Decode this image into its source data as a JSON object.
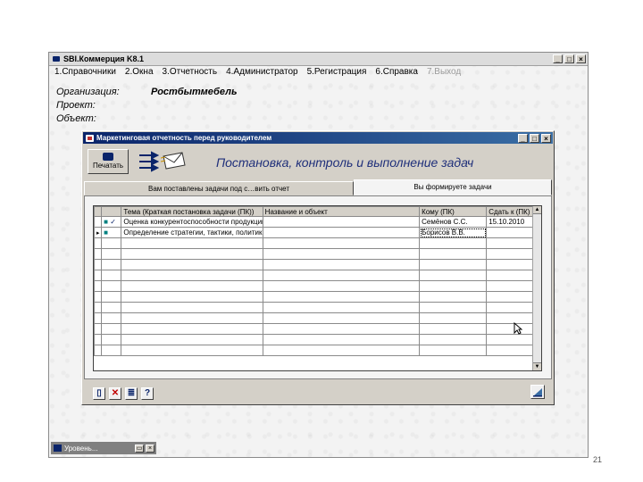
{
  "window": {
    "title": "SBI.Коммерция K8.1",
    "btn_minimize": "_",
    "btn_maximize": "□",
    "btn_close": "×"
  },
  "menu": [
    "1.Справочники",
    "2.Окна",
    "3.Отчетность",
    "4.Администратор",
    "5.Регистрация",
    "6.Справка",
    "7.Выход"
  ],
  "info": {
    "org_label": "Организация:",
    "org_value": "Ростбытмебель",
    "project_label": "Проект:",
    "object_label": "Объект:"
  },
  "dialog": {
    "title": "Маркетинговая отчетность перед руководителем",
    "print_label": "Печатать",
    "heading": "Постановка, контроль и выполнение задач",
    "tabs": [
      "Вам поставлены задачи под с…вить отчет",
      "Вы формируете задачи"
    ],
    "columns": [
      "",
      "Тема (Краткая постановка задачи (ПК))",
      "Название и объект",
      "Кому (ПК)",
      "Сдать к (ПК)"
    ],
    "rows": [
      {
        "marker": "",
        "check": "✓",
        "task": "Оценка конкурентоспособности продукции",
        "object": "",
        "to": "Семёнов С.С.",
        "due": "15.10.2010"
      },
      {
        "marker": "▸",
        "check": "",
        "task": "Определение стратегии, тактики, политики",
        "object": "",
        "to": "Борисов В.В.",
        "due": ""
      }
    ],
    "empty_rows": 11
  },
  "taskbar": {
    "minimized_title": "Уровень...",
    "btn_restore": "▭",
    "btn_close": "×"
  },
  "page_number": "21"
}
